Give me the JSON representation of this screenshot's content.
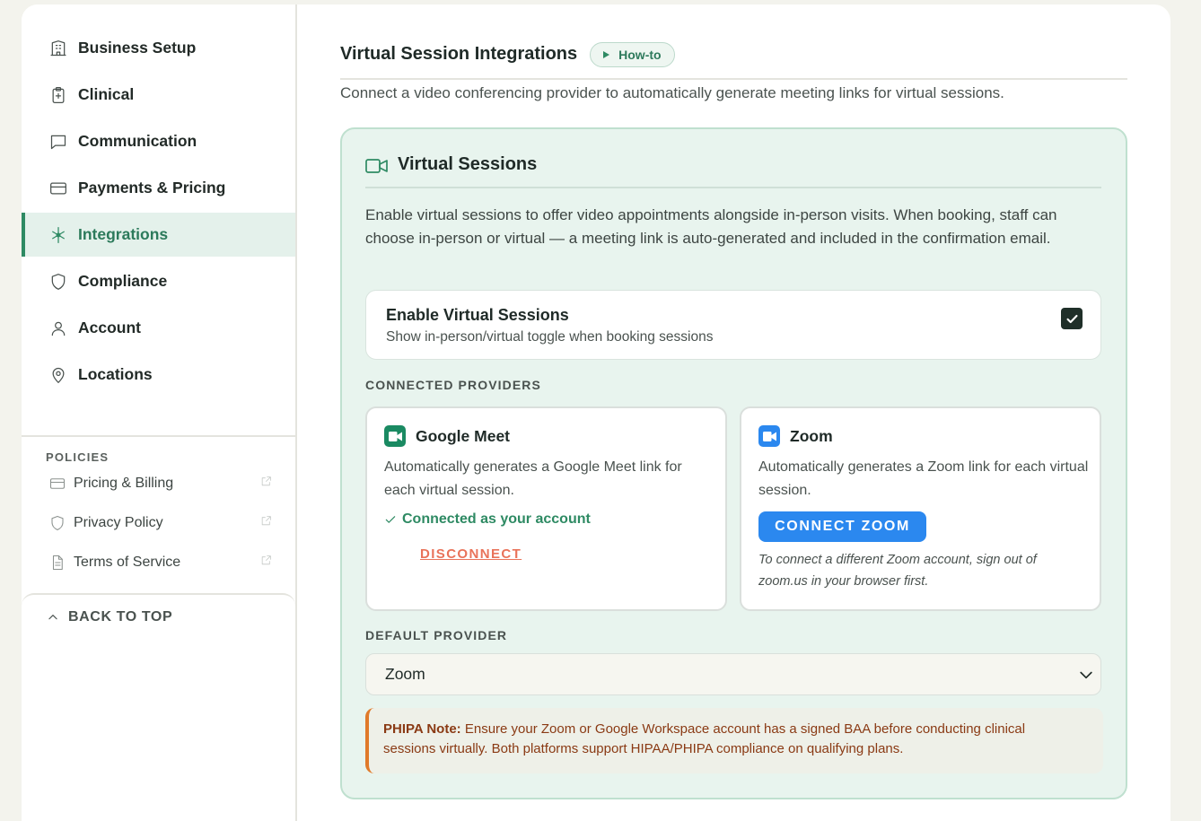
{
  "sidebar": {
    "nav": [
      {
        "label": "Business Setup",
        "icon": "building-icon"
      },
      {
        "label": "Clinical",
        "icon": "clipboard-plus-icon"
      },
      {
        "label": "Communication",
        "icon": "chat-bubble-icon"
      },
      {
        "label": "Payments & Pricing",
        "icon": "credit-card-icon"
      },
      {
        "label": "Integrations",
        "icon": "integrations-icon",
        "active": true
      },
      {
        "label": "Compliance",
        "icon": "shield-icon"
      },
      {
        "label": "Account",
        "icon": "user-icon"
      },
      {
        "label": "Locations",
        "icon": "map-pin-icon"
      }
    ],
    "policies_title": "POLICIES",
    "policies": [
      {
        "label": "Pricing & Billing",
        "icon": "credit-card-icon"
      },
      {
        "label": "Privacy Policy",
        "icon": "shield-icon"
      },
      {
        "label": "Terms of Service",
        "icon": "document-icon"
      }
    ],
    "back_to_top": "BACK TO TOP"
  },
  "main": {
    "title": "Virtual Session Integrations",
    "howto_label": "How-to",
    "description": "Connect a video conferencing provider to automatically generate meeting links for virtual sessions.",
    "card": {
      "title": "Virtual Sessions",
      "description": "Enable virtual sessions to offer video appointments alongside in-person visits. When booking, staff can choose in-person or virtual — a meeting link is auto-generated and included in the confirmation email.",
      "toggle": {
        "title": "Enable Virtual Sessions",
        "subtitle": "Show in-person/virtual toggle when booking sessions",
        "checked": true
      },
      "providers_label": "CONNECTED PROVIDERS",
      "google_meet": {
        "name": "Google Meet",
        "description": "Automatically generates a Google Meet link for each virtual session.",
        "status": "Connected as your account",
        "disconnect_label": "DISCONNECT"
      },
      "zoom": {
        "name": "Zoom",
        "description": "Automatically generates a Zoom link for each virtual session.",
        "connect_label": "CONNECT ZOOM",
        "note": "To connect a different Zoom account, sign out of zoom.us in your browser first."
      },
      "default_provider_label": "DEFAULT PROVIDER",
      "default_provider_value": "Zoom",
      "phipa_label": "PHIPA Note:",
      "phipa_text": "Ensure your Zoom or Google Workspace account has a signed BAA before conducting clinical sessions virtually. Both platforms support HIPAA/PHIPA compliance on qualifying plans."
    }
  },
  "colors": {
    "accent_green": "#2e8a63",
    "zoom_blue": "#2b88ef",
    "disconnect_red": "#e9735a",
    "warning_orange": "#e07a2a"
  }
}
